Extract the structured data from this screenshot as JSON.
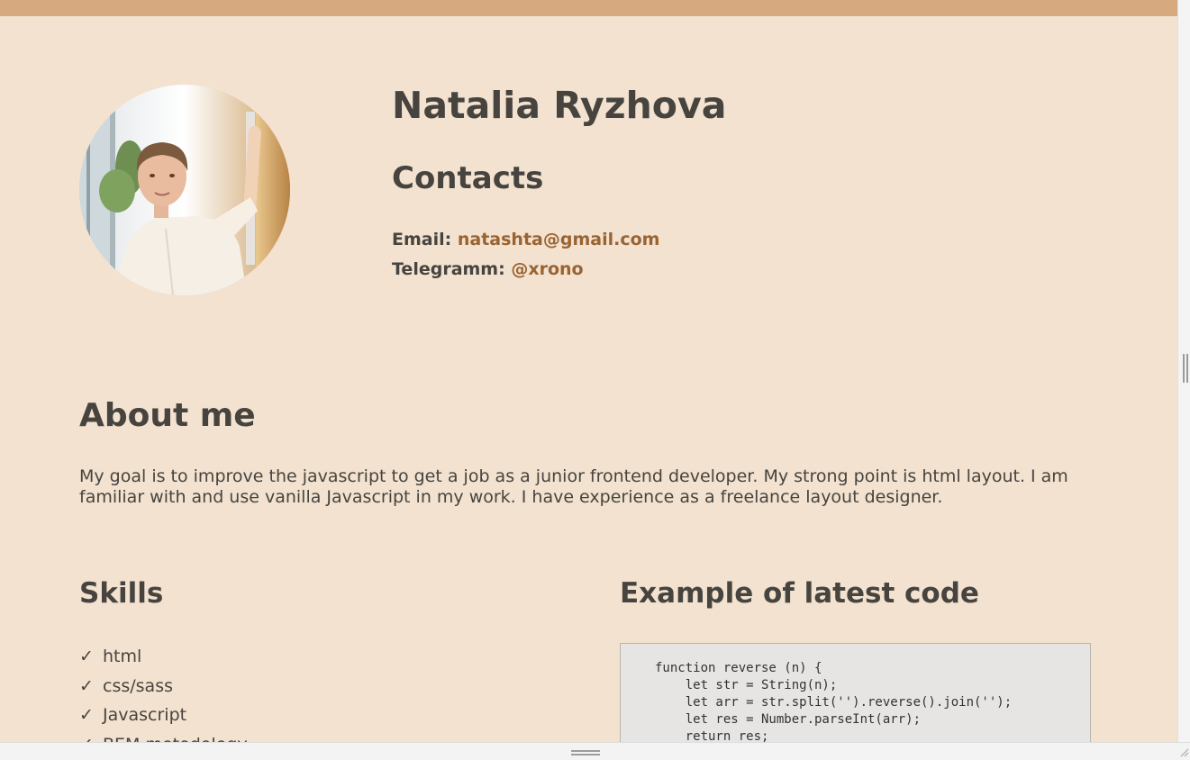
{
  "profile": {
    "name": "Natalia Ryzhova",
    "photo_alt": "profile-photo"
  },
  "contacts": {
    "title": "Contacts",
    "email_label": "Email:",
    "email_value": "natashta@gmail.com",
    "telegram_label": "Telegramm:",
    "telegram_value": "@xrono"
  },
  "about": {
    "title": "About me",
    "text": "My goal is to improve the javascript to get a job as a junior frontend developer. My strong point is html layout. I am familiar with and use vanilla Javascript in my work. I have experience as a freelance layout designer."
  },
  "skills": {
    "title": "Skills",
    "check_glyph": "✓",
    "items": [
      "html",
      "css/sass",
      "Javascript",
      "BEM metodology"
    ]
  },
  "code_example": {
    "title": "Example of latest code",
    "code": "function reverse (n) {\n    let str = String(n);\n    let arr = str.split('').reverse().join('');\n    let res = Number.parseInt(arr);\n    return res;\n}"
  },
  "colors": {
    "background": "#f2e2cf",
    "top_bar": "#d7a97f",
    "text": "#474440",
    "link": "#9a6332",
    "code_background": "#e6e5e4"
  },
  "icons": {
    "skill_marker": "check-icon",
    "panel_resize": "resize-handle-icon",
    "window_corner": "corner-resize-icon"
  }
}
